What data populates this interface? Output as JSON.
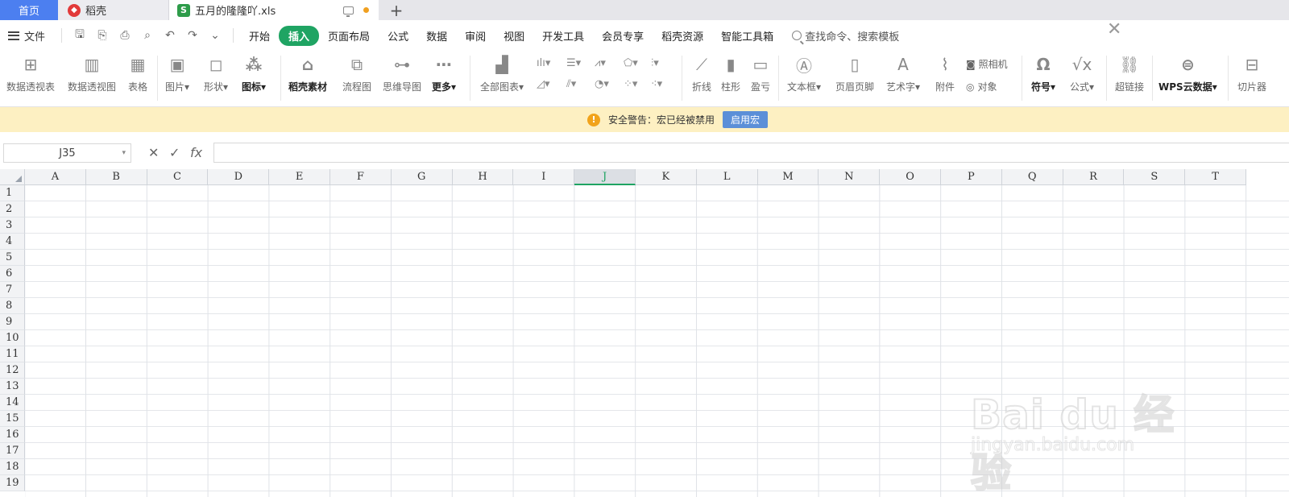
{
  "tabs": {
    "home": "首页",
    "daoke": "稻壳",
    "file": "五月的隆隆吖.xls",
    "add": "+"
  },
  "menu": {
    "file_label": "文件",
    "items": [
      "开始",
      "插入",
      "页面布局",
      "公式",
      "数据",
      "审阅",
      "视图",
      "开发工具",
      "会员专享",
      "稻壳资源",
      "智能工具箱"
    ],
    "active": "插入",
    "search_label": "查找命令、搜索模板"
  },
  "ribbon": {
    "pivot_table": "数据透视表",
    "pivot_chart": "数据透视图",
    "table": "表格",
    "picture": "图片",
    "shape": "形状",
    "icon": "图标",
    "daoke_material": "稻壳素材",
    "flowchart": "流程图",
    "mindmap": "思维导图",
    "more": "更多",
    "all_charts": "全部图表",
    "sparkline_line": "折线",
    "sparkline_column": "柱形",
    "sparkline_winloss": "盈亏",
    "textbox": "文本框",
    "header_footer": "页眉页脚",
    "wordart": "艺术字",
    "attachment": "附件",
    "camera": "照相机",
    "object": "对象",
    "symbol": "符号",
    "equation": "公式",
    "hyperlink": "超链接",
    "wps_cloud": "WPS云数据",
    "slicer": "切片器"
  },
  "warning": {
    "text": "安全警告：宏已经被禁用",
    "button": "启用宏"
  },
  "formula": {
    "cell_ref": "J35",
    "fx": "fx",
    "value": ""
  },
  "grid": {
    "columns": [
      "A",
      "B",
      "C",
      "D",
      "E",
      "F",
      "G",
      "H",
      "I",
      "J",
      "K",
      "L",
      "M",
      "N",
      "O",
      "P",
      "Q",
      "R",
      "S",
      "T"
    ],
    "selected_column": "J",
    "rows": [
      "1",
      "2",
      "3",
      "4",
      "5",
      "6",
      "7",
      "8",
      "9",
      "10",
      "11",
      "12",
      "13",
      "14",
      "15",
      "16",
      "17",
      "18",
      "19"
    ]
  },
  "watermark": {
    "logo": "Bai du 经验",
    "url": "jingyan.baidu.com"
  },
  "colors": {
    "accent": "#1fa463",
    "home_tab": "#4c7ff0",
    "warning_bg": "#fdf0c2",
    "warning_button": "#5b8fd8"
  }
}
